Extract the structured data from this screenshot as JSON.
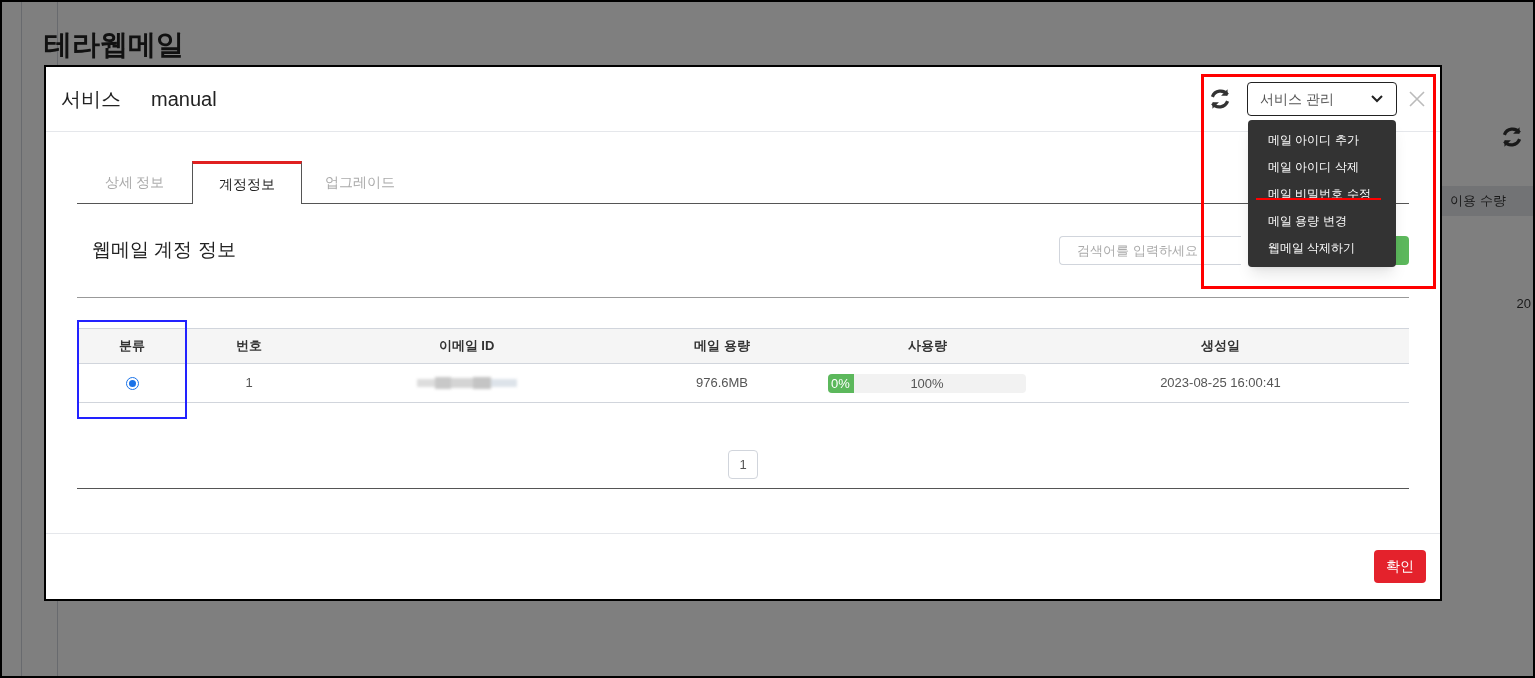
{
  "page": {
    "title": "테라웹메일",
    "background_column_header": "이용 수량",
    "background_cell": "20"
  },
  "modal": {
    "title": "서비스",
    "service_name": "manual",
    "service_select": {
      "value": "서비스 관리",
      "expanded": true,
      "options": [
        {
          "label": "메일 아이디 추가"
        },
        {
          "label": "메일 아이디 삭제"
        },
        {
          "label": "메일 비밀번호 수정"
        },
        {
          "label": "메일 용량 변경"
        },
        {
          "label": "웹메일 삭제하기"
        }
      ]
    },
    "tabs": [
      {
        "label": "상세 정보",
        "selected": false
      },
      {
        "label": "계정정보",
        "selected": true
      },
      {
        "label": "업그레이드",
        "selected": false
      }
    ],
    "section_title": "웹메일 계정 정보",
    "search": {
      "placeholder": "검색어를 입력하세요"
    },
    "table": {
      "columns": [
        "분류",
        "번호",
        "이메일 ID",
        "메일 용량",
        "사용량",
        "생성일"
      ],
      "rows": [
        {
          "selected": true,
          "number": "1",
          "capacity": "976.6MB",
          "usage": {
            "level": 0,
            "label": "0%",
            "total": "100%"
          },
          "created": "2023-08-25 16:00:41"
        }
      ]
    },
    "pagination": [
      {
        "label": "1",
        "selected": true
      }
    ],
    "confirm_button": "확인"
  }
}
